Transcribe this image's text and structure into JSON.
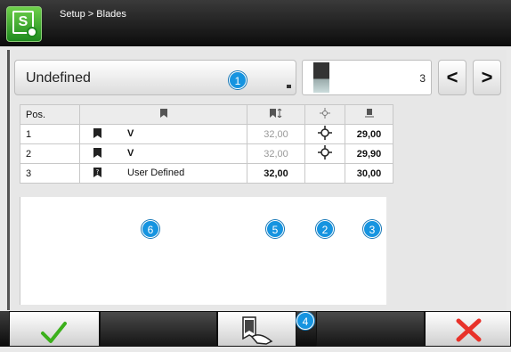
{
  "header": {
    "breadcrumb": "Setup > Blades"
  },
  "selector": {
    "value": "Undefined"
  },
  "blade_nav": {
    "number": "3",
    "prev_label": "<",
    "next_label": ">"
  },
  "table": {
    "columns": [
      "Pos.",
      "",
      "",
      "",
      ""
    ],
    "rows": [
      {
        "pos": "1",
        "name": "V",
        "height": "32,00",
        "offset": "29,00",
        "has_center_icon": true
      },
      {
        "pos": "2",
        "name": "V",
        "height": "32,00",
        "offset": "29,90",
        "has_center_icon": true
      },
      {
        "pos": "3",
        "name": "User Defined",
        "height": "32,00",
        "offset": "30,00",
        "has_center_icon": false
      }
    ]
  },
  "callouts": [
    "1",
    "2",
    "3",
    "4",
    "5",
    "6"
  ],
  "colors": {
    "callout": "#1694e0",
    "confirm": "#3cb01c",
    "cancel": "#e8322a"
  }
}
